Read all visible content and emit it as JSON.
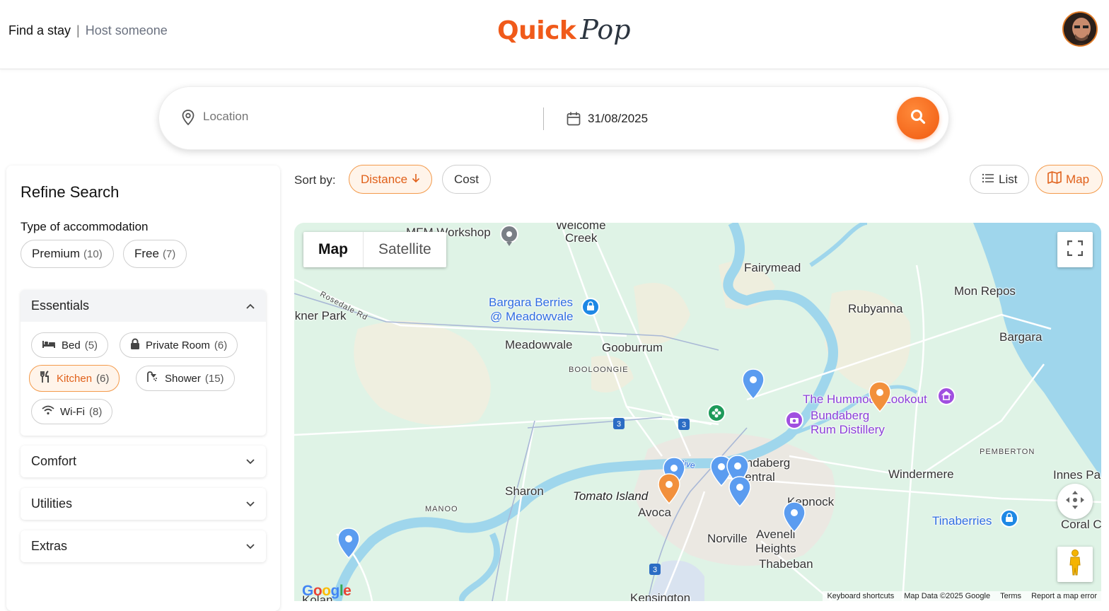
{
  "header": {
    "nav_find": "Find a stay",
    "nav_sep": "|",
    "nav_host": "Host someone",
    "logo_quick": "Quick",
    "logo_pop": "Pop"
  },
  "search": {
    "location_placeholder": "Location",
    "date": "31/08/2025"
  },
  "sidebar": {
    "title": "Refine Search",
    "type_label": "Type of accommodation",
    "types": [
      {
        "label": "Premium",
        "count": "(10)"
      },
      {
        "label": "Free",
        "count": "(7)"
      }
    ],
    "sections": [
      "Essentials",
      "Comfort",
      "Utilities",
      "Extras"
    ],
    "essentials": [
      {
        "label": "Bed",
        "count": "(5)",
        "icon": "bed-icon"
      },
      {
        "label": "Private Room",
        "count": "(6)",
        "icon": "lock-icon"
      },
      {
        "label": "Kitchen",
        "count": "(6)",
        "icon": "utensils-icon",
        "selected": true
      },
      {
        "label": "Shower",
        "count": "(15)",
        "icon": "shower-icon"
      },
      {
        "label": "Wi-Fi",
        "count": "(8)",
        "icon": "wifi-icon"
      }
    ]
  },
  "sort": {
    "label": "Sort by:",
    "distance": "Distance",
    "cost": "Cost"
  },
  "view": {
    "list": "List",
    "map": "Map"
  },
  "map": {
    "type_map": "Map",
    "type_satellite": "Satellite",
    "places": {
      "welcome_creek_1": "Welcome",
      "welcome_creek_2": "Creek",
      "mfm": "MFM Workshop",
      "fairymead": "Fairymead",
      "mon_repos": "Mon Repos",
      "rubyanna": "Rubyanna",
      "bargara": "Bargara",
      "bargara_berries_1": "Bargara Berries",
      "bargara_berries_2": "@ Meadowvale",
      "kner_park": "lkner Park",
      "rosedale": "Rosedale Rd",
      "meadowvale": "Meadowvale",
      "gooburrum": "Gooburrum",
      "booloongie": "BOOLOONGIE",
      "hummock": "The Hummock Lookout",
      "rum_1": "Bundaberg",
      "rum_2": "Rum Distillery",
      "pemberton": "PEMBERTON",
      "windermere": "Windermere",
      "innes": "Innes Pa",
      "bundaberg_1": "Bundaberg",
      "bundaberg_2": "Central",
      "kepnock": "Kepnock",
      "sharon": "Sharon",
      "tomato": "Tomato Island",
      "avoca": "Avoca",
      "manoo": "MANOO",
      "norville": "Norville",
      "avenell_1": "Avenell",
      "avenell_2": "Heights",
      "thabeban": "Thabeban",
      "tinaberries": "Tinaberries",
      "coral": "Coral C",
      "kensington": "Kensington",
      "kolan": "Kolan",
      "burnett_river": "tt Rive"
    },
    "attribution": [
      "Keyboard shortcuts",
      "Map Data ©2025 Google",
      "Terms",
      "Report a map error"
    ],
    "google": "Google",
    "colors": {
      "land": "#dff3e6",
      "water": "#9fd6ec",
      "road": "#ffffff",
      "pin_blue": "#5b9cf0",
      "pin_orange": "#f2903c"
    }
  }
}
